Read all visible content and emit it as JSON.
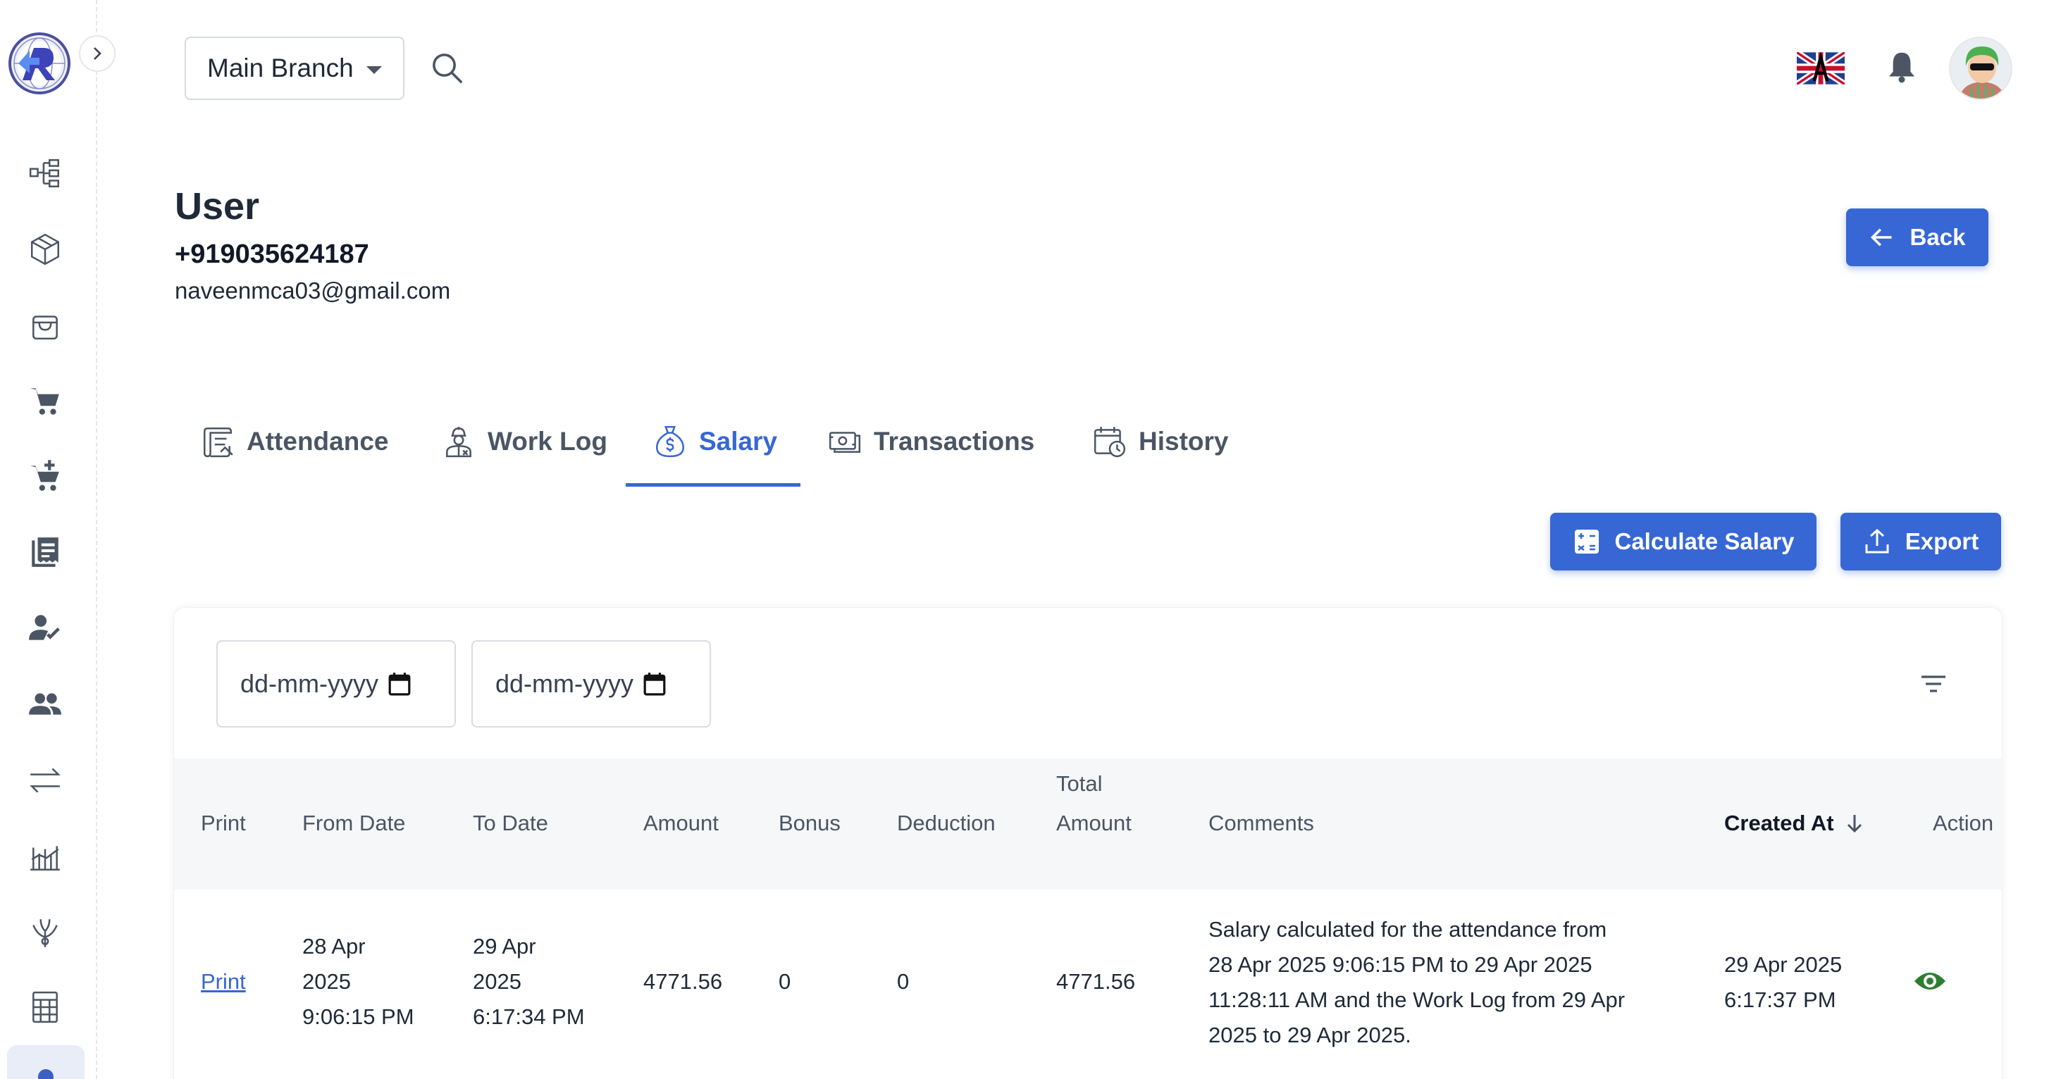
{
  "header": {
    "branch": "Main Branch"
  },
  "user": {
    "title": "User",
    "phone": "+919035624187",
    "email": "naveenmca03@gmail.com"
  },
  "actions": {
    "back": "Back",
    "calculate": "Calculate Salary",
    "export": "Export"
  },
  "tabs": [
    {
      "label": "Attendance",
      "icon": "attendance-icon"
    },
    {
      "label": "Work Log",
      "icon": "worker-icon"
    },
    {
      "label": "Salary",
      "icon": "money-bag-icon",
      "active": true
    },
    {
      "label": "Transactions",
      "icon": "cash-icon"
    },
    {
      "label": "History",
      "icon": "calendar-clock-icon"
    }
  ],
  "filters": {
    "from_placeholder": "dd-mm-yyyy",
    "to_placeholder": "dd-mm-yyyy"
  },
  "table": {
    "columns": {
      "print": "Print",
      "from_date": "From Date",
      "to_date": "To Date",
      "amount": "Amount",
      "bonus": "Bonus",
      "deduction": "Deduction",
      "total_amount_1": "Total",
      "total_amount_2": "Amount",
      "comments": "Comments",
      "created_at": "Created At",
      "action": "Action"
    },
    "rows": [
      {
        "print": "Print",
        "from_date": [
          "28 Apr",
          "2025",
          "9:06:15 PM"
        ],
        "to_date": [
          "29 Apr",
          "2025",
          "6:17:34 PM"
        ],
        "amount": "4771.56",
        "bonus": "0",
        "deduction": "0",
        "total_amount": "4771.56",
        "comments": [
          "Salary calculated for the attendance from",
          "28 Apr 2025 9:06:15 PM to 29 Apr 2025",
          "11:28:11 AM and the Work Log from 29 Apr",
          "2025 to 29 Apr 2025."
        ],
        "created_at": [
          "29 Apr 2025",
          "6:17:37 PM"
        ]
      }
    ]
  },
  "colors": {
    "primary": "#3767d4",
    "eye": "#2e7d32"
  }
}
